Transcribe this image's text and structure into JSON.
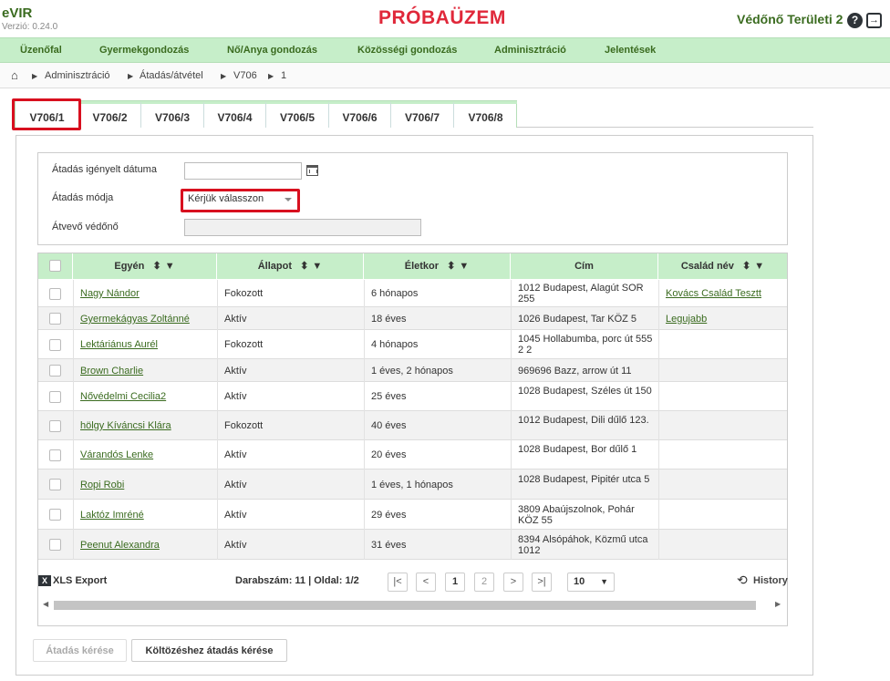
{
  "app": {
    "name": "eVIR",
    "version": "Verzió: 0.24.0",
    "mode": "PRÓBAÜZEM",
    "user": "Védőnő Területi 2"
  },
  "menu": [
    "Üzenőfal",
    "Gyermekgondozás",
    "Nő/Anya gondozás",
    "Közösségi gondozás",
    "Adminisztráció",
    "Jelentések"
  ],
  "breadcrumb": [
    "Adminisztráció",
    "Átadás/átvétel",
    "V706",
    "1"
  ],
  "tabs": [
    "V706/1",
    "V706/2",
    "V706/3",
    "V706/4",
    "V706/5",
    "V706/6",
    "V706/7",
    "V706/8"
  ],
  "form": {
    "date_label": "Átadás igényelt dátuma",
    "date_value": "",
    "mode_label": "Átadás módja",
    "mode_value": "Kérjük válasszon",
    "receiver_label": "Átvevő védőnő",
    "receiver_value": ""
  },
  "table": {
    "headers": [
      "Egyén",
      "Állapot",
      "Életkor",
      "Cím",
      "Család név"
    ],
    "rows": [
      {
        "name": "Nagy Nándor",
        "status": "Fokozott",
        "age": "6 hónapos",
        "address": "1012 Budapest, Alagút SOR 255",
        "family": "Kovács Család Tesztt"
      },
      {
        "name": "Gyermekágyas Zoltánné",
        "status": "Aktív",
        "age": "18 éves",
        "address": "1026 Budapest, Tar KÖZ 5",
        "family": "Legujabb"
      },
      {
        "name": "Lektáriánus Aurél",
        "status": "Fokozott",
        "age": "4 hónapos",
        "address": "1045 Hollabumba, porc út 555 2 2",
        "family": ""
      },
      {
        "name": "Brown Charlie",
        "status": "Aktív",
        "age": "1 éves, 2 hónapos",
        "address": "969696 Bazz, arrow út 11",
        "family": ""
      },
      {
        "name": "Nővédelmi Cecilia2",
        "status": "Aktív",
        "age": "25 éves",
        "address": "1028 Budapest, Széles út 150",
        "family": ""
      },
      {
        "name": "hölgy Kíváncsi Klára",
        "status": "Fokozott",
        "age": "40 éves",
        "address": "1012 Budapest, Dili dűlő 123.",
        "family": ""
      },
      {
        "name": "Várandós Lenke",
        "status": "Aktív",
        "age": "20 éves",
        "address": "1028 Budapest, Bor dűlő 1",
        "family": ""
      },
      {
        "name": "Ropi Robi",
        "status": "Aktív",
        "age": "1 éves, 1 hónapos",
        "address": "1028 Budapest, Pipitér utca 5",
        "family": ""
      },
      {
        "name": "Laktóz Imréné",
        "status": "Aktív",
        "age": "29 éves",
        "address": "3809 Abaújszolnok, Pohár KÖZ 55",
        "family": ""
      },
      {
        "name": "Peenut Alexandra",
        "status": "Aktív",
        "age": "31 éves",
        "address": "8394 Alsópáhok, Közmű utca 1012",
        "family": ""
      }
    ]
  },
  "pager": {
    "export": "XLS Export",
    "summary": "Darabszám: 11 | Oldal: 1/2",
    "page1": "1",
    "page2": "2",
    "page_size": "10",
    "history": "History"
  },
  "actions": {
    "request": "Átadás kérése",
    "move_request": "Költözéshez átadás kérése"
  },
  "colors": {
    "brand_green": "#3a6b1f",
    "menu_bg": "#c6eec9",
    "mode_red": "#e0283a",
    "highlight": "#d8101f"
  }
}
